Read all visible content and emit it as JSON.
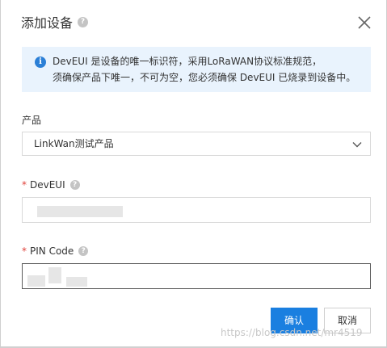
{
  "dialog": {
    "title": "添加设备",
    "help_glyph": "?",
    "close_icon": "close-icon"
  },
  "notice": {
    "icon_glyph": "i",
    "line1": "DevEUI 是设备的唯一标识符，采用LoRaWAN协议标准规范，",
    "line2": "须确保产品下唯一，不可为空，您必须确保 DevEUI 已烧录到设备中。",
    "background_color": "#e9f3fd",
    "icon_color": "#2b7fd6"
  },
  "product": {
    "label": "产品",
    "selected": "LinkWan测试产品"
  },
  "deveui": {
    "required_mark": "*",
    "label": "DevEUI",
    "help_glyph": "?"
  },
  "pin": {
    "required_mark": "*",
    "label": "PIN Code",
    "help_glyph": "?"
  },
  "footer": {
    "confirm_label": "确认",
    "cancel_label": "取消",
    "primary_color": "#1a7fe0"
  },
  "watermark": "https://blog.csdn.net/mr4519"
}
